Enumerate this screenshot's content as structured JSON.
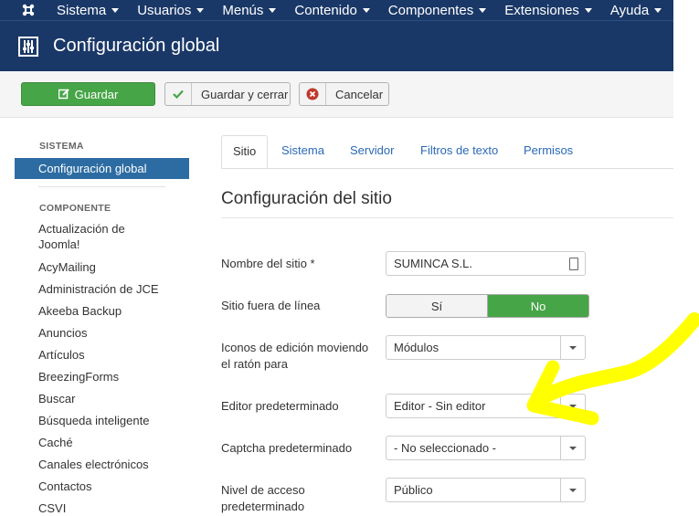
{
  "navbar": {
    "logo_icon": "joomla-logo-icon",
    "menus": [
      "Sistema",
      "Usuarios",
      "Menús",
      "Contenido",
      "Componentes",
      "Extensiones",
      "Ayuda"
    ]
  },
  "header": {
    "icon": "equalizer-icon",
    "title": "Configuración global"
  },
  "toolbar": {
    "save_label": "Guardar",
    "save_close_label": "Guardar y cerrar",
    "cancel_label": "Cancelar"
  },
  "sidebar": {
    "system_heading": "SISTEMA",
    "active_item": "Configuración global",
    "component_heading": "COMPONENTE",
    "items": [
      "Actualización de Joomla!",
      "AcyMailing",
      "Administración de JCE",
      "Akeeba Backup",
      "Anuncios",
      "Artículos",
      "BreezingForms",
      "Buscar",
      "Búsqueda inteligente",
      "Caché",
      "Canales electrónicos",
      "Contactos",
      "CSVI"
    ]
  },
  "tabs": [
    "Sitio",
    "Sistema",
    "Servidor",
    "Filtros de texto",
    "Permisos"
  ],
  "active_tab": "Sitio",
  "section_title": "Configuración del sitio",
  "form": {
    "site_name_label": "Nombre del sitio *",
    "site_name_value": "SUMINCA S.L.",
    "offline_label": "Sitio fuera de línea",
    "offline_yes": "Sí",
    "offline_no": "No",
    "offline_selected": "No",
    "edit_icons_label": "Iconos de edición moviendo el ratón para",
    "edit_icons_value": "Módulos",
    "editor_label": "Editor predeterminado",
    "editor_value": "Editor - Sin editor",
    "captcha_label": "Captcha predeterminado",
    "captcha_value": "- No seleccionado -",
    "access_label": "Nivel de acceso predeterminado",
    "access_value": "Público"
  },
  "colors": {
    "navbar": "#1a3867",
    "save_green": "#46a546",
    "sidebar_active": "#2d6ca2",
    "tab_link": "#2a69b8",
    "annotation": "#ffff00"
  }
}
